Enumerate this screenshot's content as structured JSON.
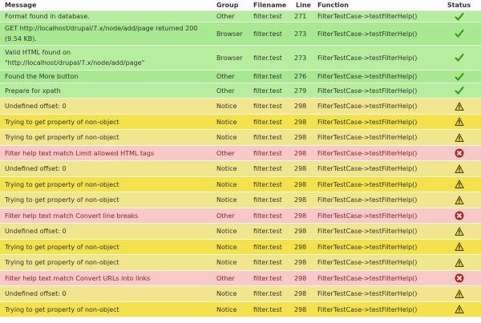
{
  "header": {
    "message": "Message",
    "group": "Group",
    "filename": "Filename",
    "line": "Line",
    "function": "Function",
    "status": "Status"
  },
  "rows": [
    {
      "message": "Format found in database.",
      "group": "Other",
      "filename": "filter.test",
      "line": "271",
      "function": "FilterTestCase->testFilterHelp()",
      "status": "pass",
      "icon": "check-icon"
    },
    {
      "message": "GET http://localhost/drupal/7.x/node/add/page returned 200 (9.54 KB).",
      "group": "Browser",
      "filename": "filter.test",
      "line": "273",
      "function": "FilterTestCase->testFilterHelp()",
      "status": "pass",
      "icon": "check-icon"
    },
    {
      "message": "Valid HTML found on \"http://localhost/drupal/7.x/node/add/page\"",
      "group": "Browser",
      "filename": "filter.test",
      "line": "273",
      "function": "FilterTestCase->testFilterHelp()",
      "status": "pass",
      "icon": "check-icon"
    },
    {
      "message": "Found the More button",
      "group": "Other",
      "filename": "filter.test",
      "line": "276",
      "function": "FilterTestCase->testFilterHelp()",
      "status": "pass",
      "icon": "check-icon"
    },
    {
      "message": "Prepare for xpath",
      "group": "Other",
      "filename": "filter.test",
      "line": "279",
      "function": "FilterTestCase->testFilterHelp()",
      "status": "pass",
      "icon": "check-icon"
    },
    {
      "message": "Undefined offset: 0",
      "group": "Notice",
      "filename": "filter.test",
      "line": "298",
      "function": "FilterTestCase->testFilterHelp()",
      "status": "warn",
      "icon": "warning-icon"
    },
    {
      "message": "Trying to get property of non-object",
      "group": "Notice",
      "filename": "filter.test",
      "line": "298",
      "function": "FilterTestCase->testFilterHelp()",
      "status": "warn",
      "icon": "warning-icon"
    },
    {
      "message": "Trying to get property of non-object",
      "group": "Notice",
      "filename": "filter.test",
      "line": "298",
      "function": "FilterTestCase->testFilterHelp()",
      "status": "warn",
      "icon": "warning-icon"
    },
    {
      "message": "Filter help text match Limit allowed HTML tags",
      "group": "Other",
      "filename": "filter.test",
      "line": "298",
      "function": "FilterTestCase->testFilterHelp()",
      "status": "fail",
      "icon": "error-icon"
    },
    {
      "message": "Undefined offset: 0",
      "group": "Notice",
      "filename": "filter.test",
      "line": "298",
      "function": "FilterTestCase->testFilterHelp()",
      "status": "warn",
      "icon": "warning-icon"
    },
    {
      "message": "Trying to get property of non-object",
      "group": "Notice",
      "filename": "filter.test",
      "line": "298",
      "function": "FilterTestCase->testFilterHelp()",
      "status": "warn",
      "icon": "warning-icon"
    },
    {
      "message": "Trying to get property of non-object",
      "group": "Notice",
      "filename": "filter.test",
      "line": "298",
      "function": "FilterTestCase->testFilterHelp()",
      "status": "warn",
      "icon": "warning-icon"
    },
    {
      "message": "Filter help text match Convert line breaks",
      "group": "Other",
      "filename": "filter.test",
      "line": "298",
      "function": "FilterTestCase->testFilterHelp()",
      "status": "fail",
      "icon": "error-icon"
    },
    {
      "message": "Undefined offset: 0",
      "group": "Notice",
      "filename": "filter.test",
      "line": "298",
      "function": "FilterTestCase->testFilterHelp()",
      "status": "warn",
      "icon": "warning-icon"
    },
    {
      "message": "Trying to get property of non-object",
      "group": "Notice",
      "filename": "filter.test",
      "line": "298",
      "function": "FilterTestCase->testFilterHelp()",
      "status": "warn",
      "icon": "warning-icon"
    },
    {
      "message": "Trying to get property of non-object",
      "group": "Notice",
      "filename": "filter.test",
      "line": "298",
      "function": "FilterTestCase->testFilterHelp()",
      "status": "warn",
      "icon": "warning-icon"
    },
    {
      "message": "Filter help text match Convert URLs into links",
      "group": "Other",
      "filename": "filter.test",
      "line": "298",
      "function": "FilterTestCase->testFilterHelp()",
      "status": "fail",
      "icon": "error-icon"
    },
    {
      "message": "Undefined offset: 0",
      "group": "Notice",
      "filename": "filter.test",
      "line": "298",
      "function": "FilterTestCase->testFilterHelp()",
      "status": "warn",
      "icon": "warning-icon"
    },
    {
      "message": "Trying to get property of non-object",
      "group": "Notice",
      "filename": "filter.test",
      "line": "298",
      "function": "FilterTestCase->testFilterHelp()",
      "status": "warn",
      "icon": "warning-icon"
    }
  ],
  "colors": {
    "pass": "#b6ed9e",
    "warn": "#f3e24c",
    "fail": "#f7c9c9",
    "check": "#2f9a16",
    "warning_fill": "#f7d21a",
    "error_fill": "#cc2a2a"
  }
}
